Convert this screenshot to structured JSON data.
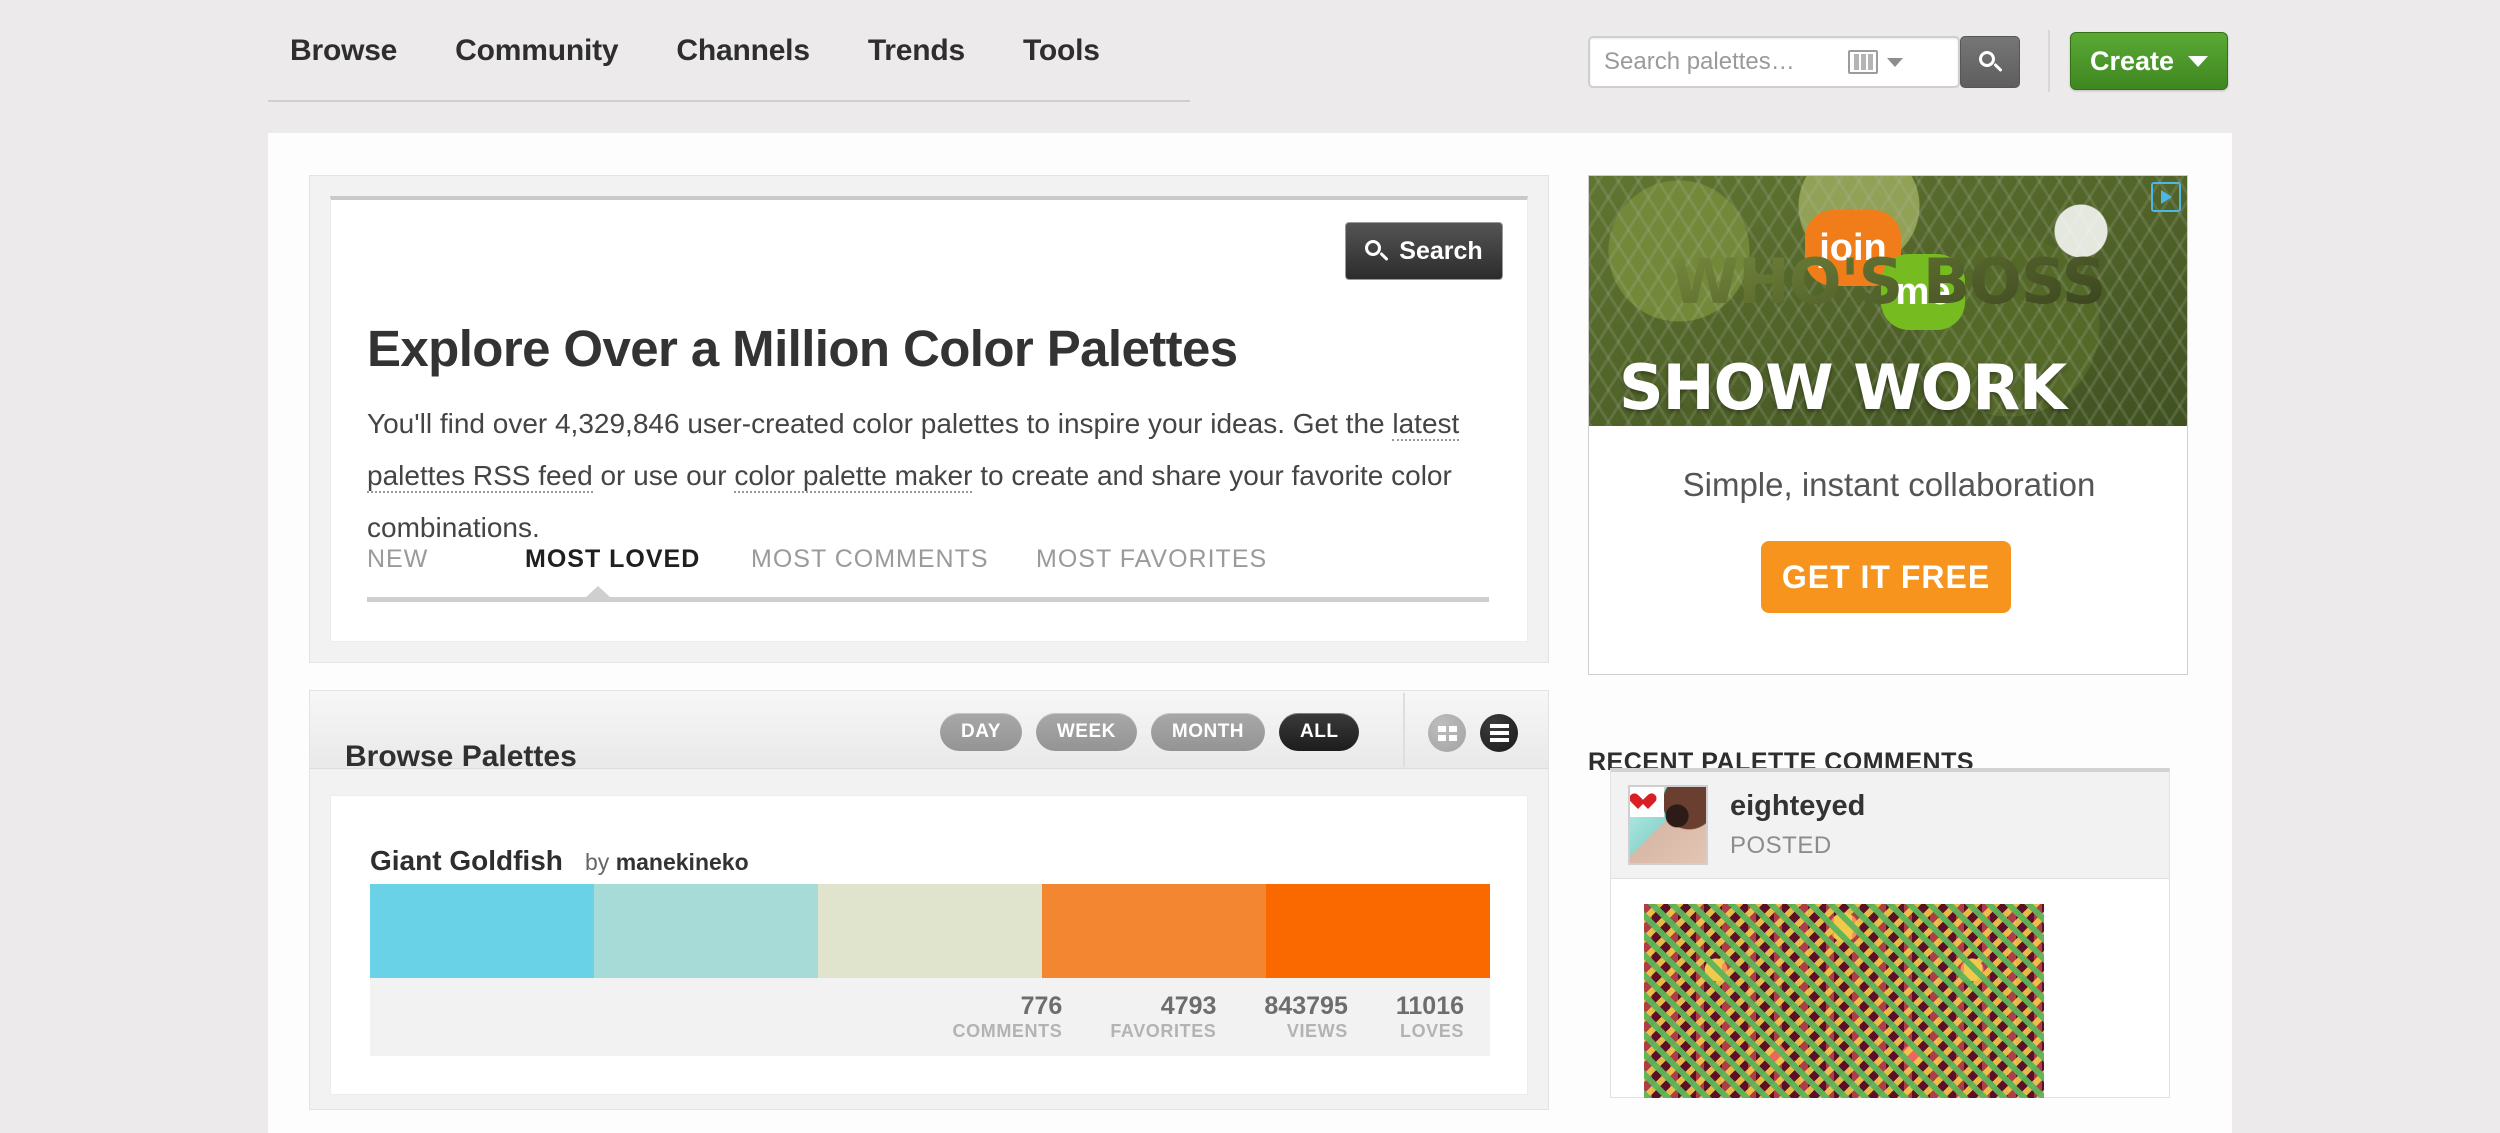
{
  "nav": {
    "items": [
      {
        "label": "Browse"
      },
      {
        "label": "Community"
      },
      {
        "label": "Channels"
      },
      {
        "label": "Trends"
      },
      {
        "label": "Tools"
      }
    ]
  },
  "search": {
    "placeholder": "Search palettes…",
    "value": "",
    "filter_icon": "palette-columns-icon",
    "submit_icon": "magnifier-icon"
  },
  "create": {
    "label": "Create",
    "caret_icon": "chevron-down-icon",
    "color": "#4a9229"
  },
  "hero": {
    "search_button": "Search",
    "search_icon": "magnifier-icon",
    "title": "Explore Over a Million Color Palettes",
    "desc_part1": "You'll find over 4,329,846 user-created color palettes to inspire your ideas. Get the ",
    "link_rss": "latest palettes RSS feed",
    "desc_part2": " or use our ",
    "link_maker": "color palette maker",
    "desc_part3": " to create and share your favorite color combinations.",
    "palette_count": "4,329,846",
    "tabs": [
      {
        "label": "NEW",
        "active": false
      },
      {
        "label": "MOST LOVED",
        "active": true
      },
      {
        "label": "MOST COMMENTS",
        "active": false
      },
      {
        "label": "MOST FAVORITES",
        "active": false
      }
    ]
  },
  "browse": {
    "title": "Browse Palettes",
    "time_filters": [
      {
        "label": "DAY",
        "active": false
      },
      {
        "label": "WEEK",
        "active": false
      },
      {
        "label": "MONTH",
        "active": false
      },
      {
        "label": "ALL",
        "active": true
      }
    ],
    "views": [
      {
        "icon": "grid-view-icon",
        "active": false
      },
      {
        "icon": "list-view-icon",
        "active": true
      }
    ]
  },
  "palette": {
    "name": "Giant Goldfish",
    "by_prefix": "by",
    "author": "manekineko",
    "colors": [
      "#69D2E7",
      "#A7DBD8",
      "#E0E4CC",
      "#F38630",
      "#FA6900"
    ],
    "stats": [
      {
        "value": "776",
        "label": "COMMENTS"
      },
      {
        "value": "4793",
        "label": "FAVORITES"
      },
      {
        "value": "843795",
        "label": "VIEWS"
      },
      {
        "value": "11016",
        "label": "LOVES"
      }
    ]
  },
  "ad": {
    "bubble_join": "join",
    "bubble_me": "me",
    "headline_line1": "SHOW WORK",
    "headline_line2": "WHO'S BOSS",
    "tagline": "Simple, instant collaboration",
    "cta": "GET IT FREE",
    "choice_icon": "ad-choice-icon",
    "cta_color": "#f7941e",
    "join_color": "#f07d1a",
    "me_color": "#76bc21"
  },
  "comments": {
    "title": "RECENT PALETTE COMMENTS",
    "items": [
      {
        "user": "eighteyed",
        "action": "POSTED",
        "badge_icon": "heart-icon",
        "avatar_icon": "user-avatar"
      }
    ]
  }
}
